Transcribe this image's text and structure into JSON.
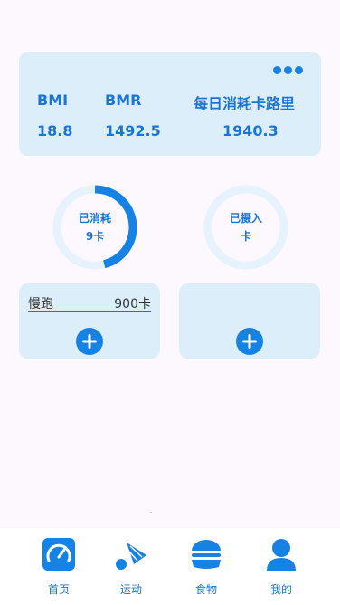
{
  "stats": {
    "bmi_label": "BMI",
    "bmi_value": "18.8",
    "bmr_label": "BMR",
    "bmr_value": "1492.5",
    "daily_label": "每日消耗卡路里",
    "daily_value": "1940.3"
  },
  "rings": {
    "burned": {
      "line1": "已消耗",
      "line2": "9卡",
      "progress": 0.46
    },
    "intake": {
      "line1": "已摄入",
      "line2": "卡",
      "progress": 0
    }
  },
  "exercise_card": {
    "entries": [
      {
        "name": "慢跑",
        "calories": "900卡"
      }
    ]
  },
  "tabs": [
    {
      "label": "首页",
      "icon": "speedometer-icon"
    },
    {
      "label": "运动",
      "icon": "badminton-icon"
    },
    {
      "label": "食物",
      "icon": "burger-icon"
    },
    {
      "label": "我的",
      "icon": "person-icon"
    }
  ],
  "colors": {
    "accent": "#1683e4",
    "card_bg": "#dceefa",
    "ring_bg": "#e6f2fc",
    "page_bg": "#fcf8fe"
  }
}
